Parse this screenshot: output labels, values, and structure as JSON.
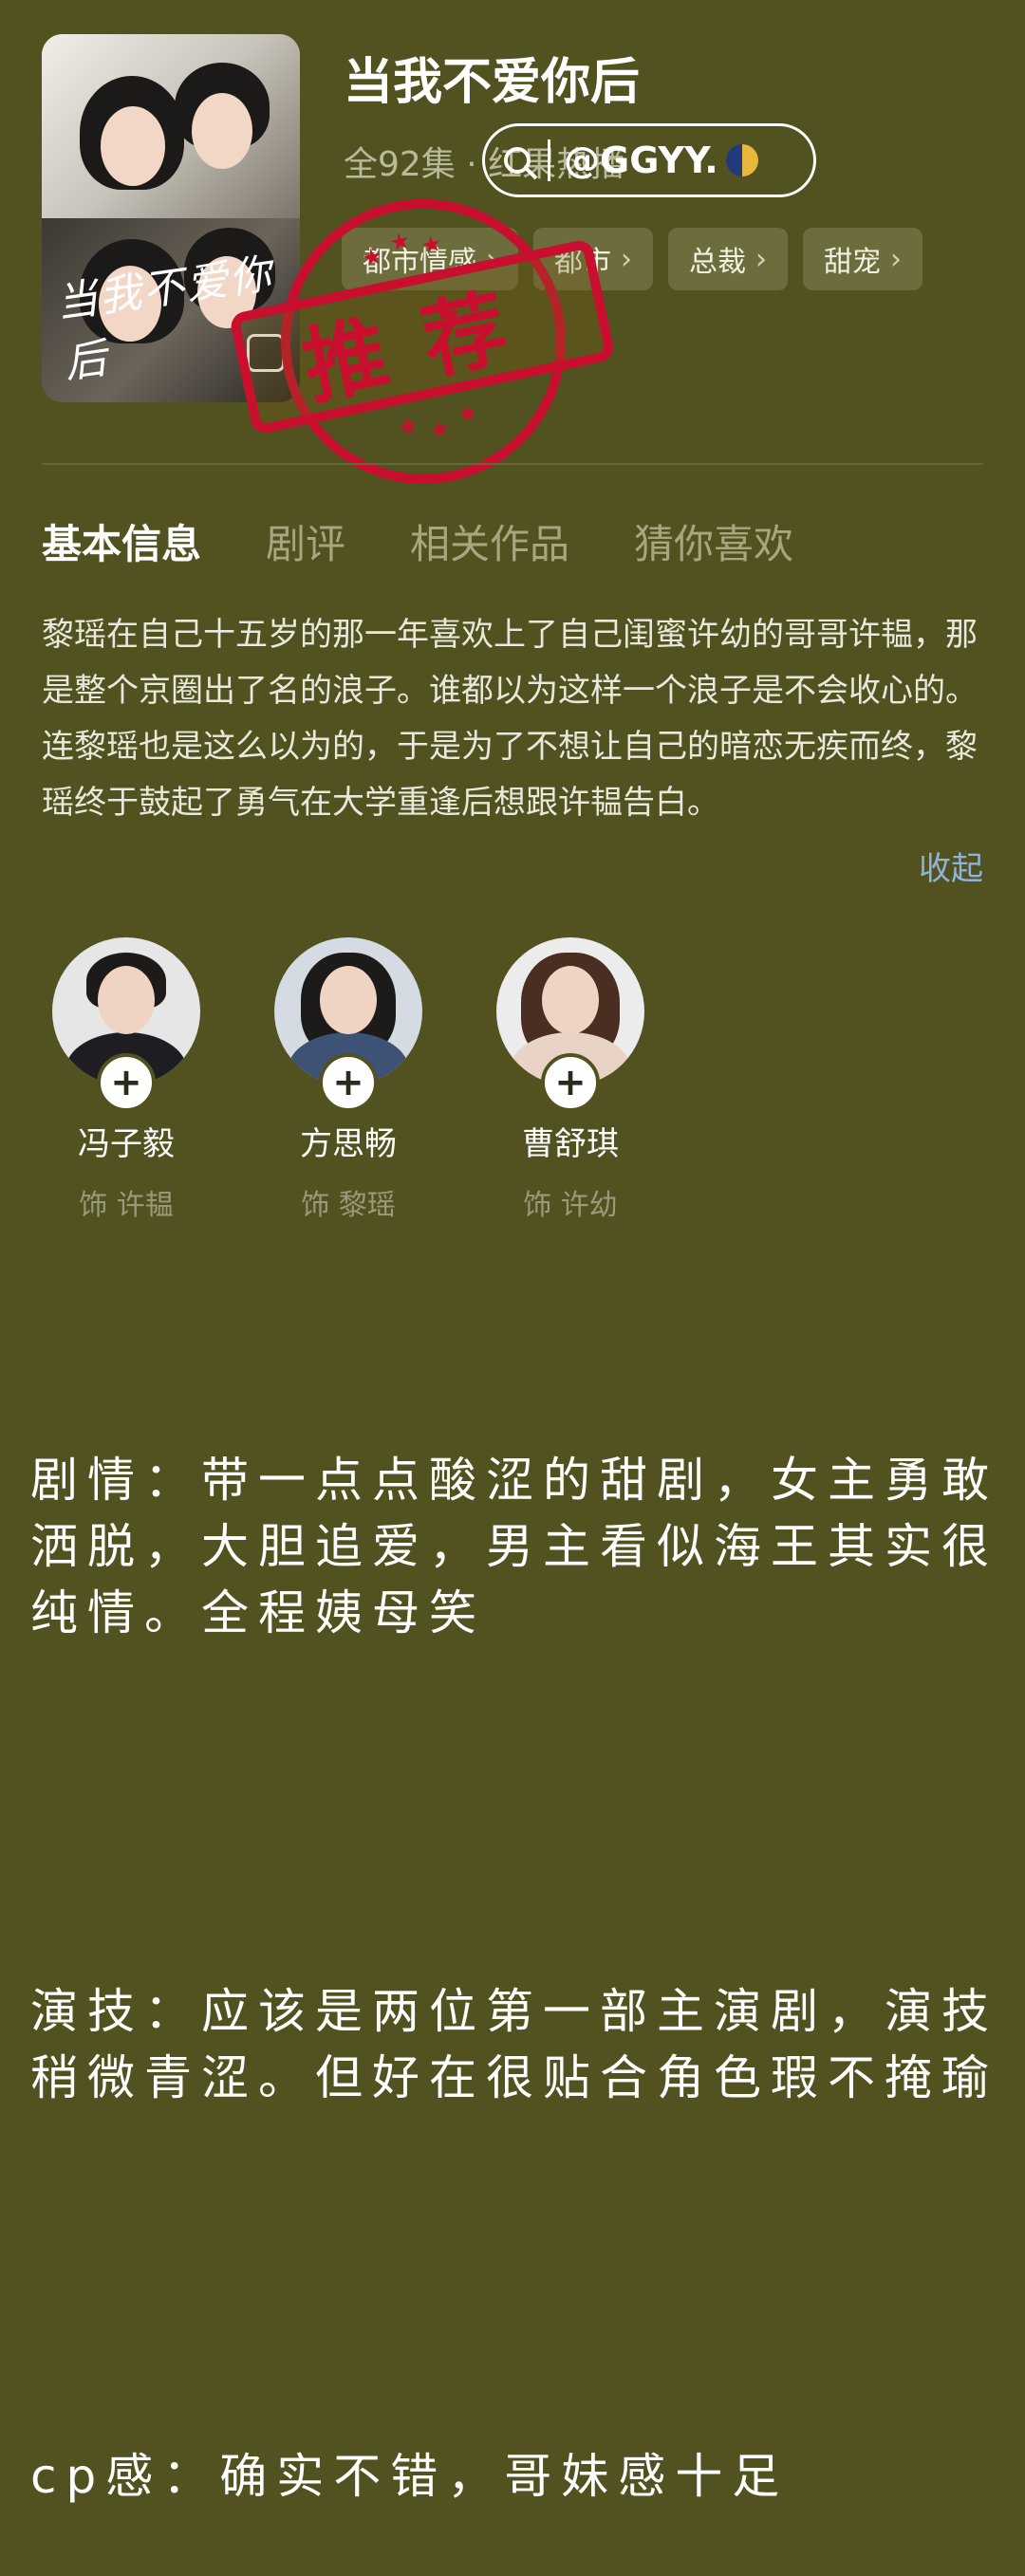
{
  "drama": {
    "title": "当我不爱你后",
    "meta": "全92集 · 红果热播",
    "tags": [
      "都市情感",
      "都市",
      "总裁",
      "甜宠"
    ],
    "poster_signature": "当我不爱你后"
  },
  "watermark": {
    "handle": "@GGYY."
  },
  "stamp": {
    "text": "推荐"
  },
  "tabs": [
    "基本信息",
    "剧评",
    "相关作品",
    "猜你喜欢"
  ],
  "synopsis": "黎瑶在自己十五岁的那一年喜欢上了自己闺蜜许幼的哥哥许韫，那是整个京圈出了名的浪子。谁都以为这样一个浪子是不会收心的。连黎瑶也是这么以为的，于是为了不想让自己的暗恋无疾而终，黎瑶终于鼓起了勇气在大学重逢后想跟许韫告白。",
  "collapse_label": "收起",
  "cast": [
    {
      "name": "冯子毅",
      "role": "饰 许韫"
    },
    {
      "name": "方思畅",
      "role": "饰 黎瑶"
    },
    {
      "name": "曹舒琪",
      "role": "饰 许幼"
    }
  ],
  "review": {
    "plot": "剧情：带一点点酸涩的甜剧，女主勇敢洒脱，大胆追爱，男主看似海王其实很纯情。全程姨母笑",
    "acting": "演技：应该是两位第一部主演剧，演技稍微青涩。但好在很贴合角色瑕不掩瑜",
    "cp": "cp感：确实不错，哥妹感十足"
  },
  "colors": {
    "background": "#525220",
    "stamp": "#c8102e",
    "link": "#8fb3d9"
  }
}
